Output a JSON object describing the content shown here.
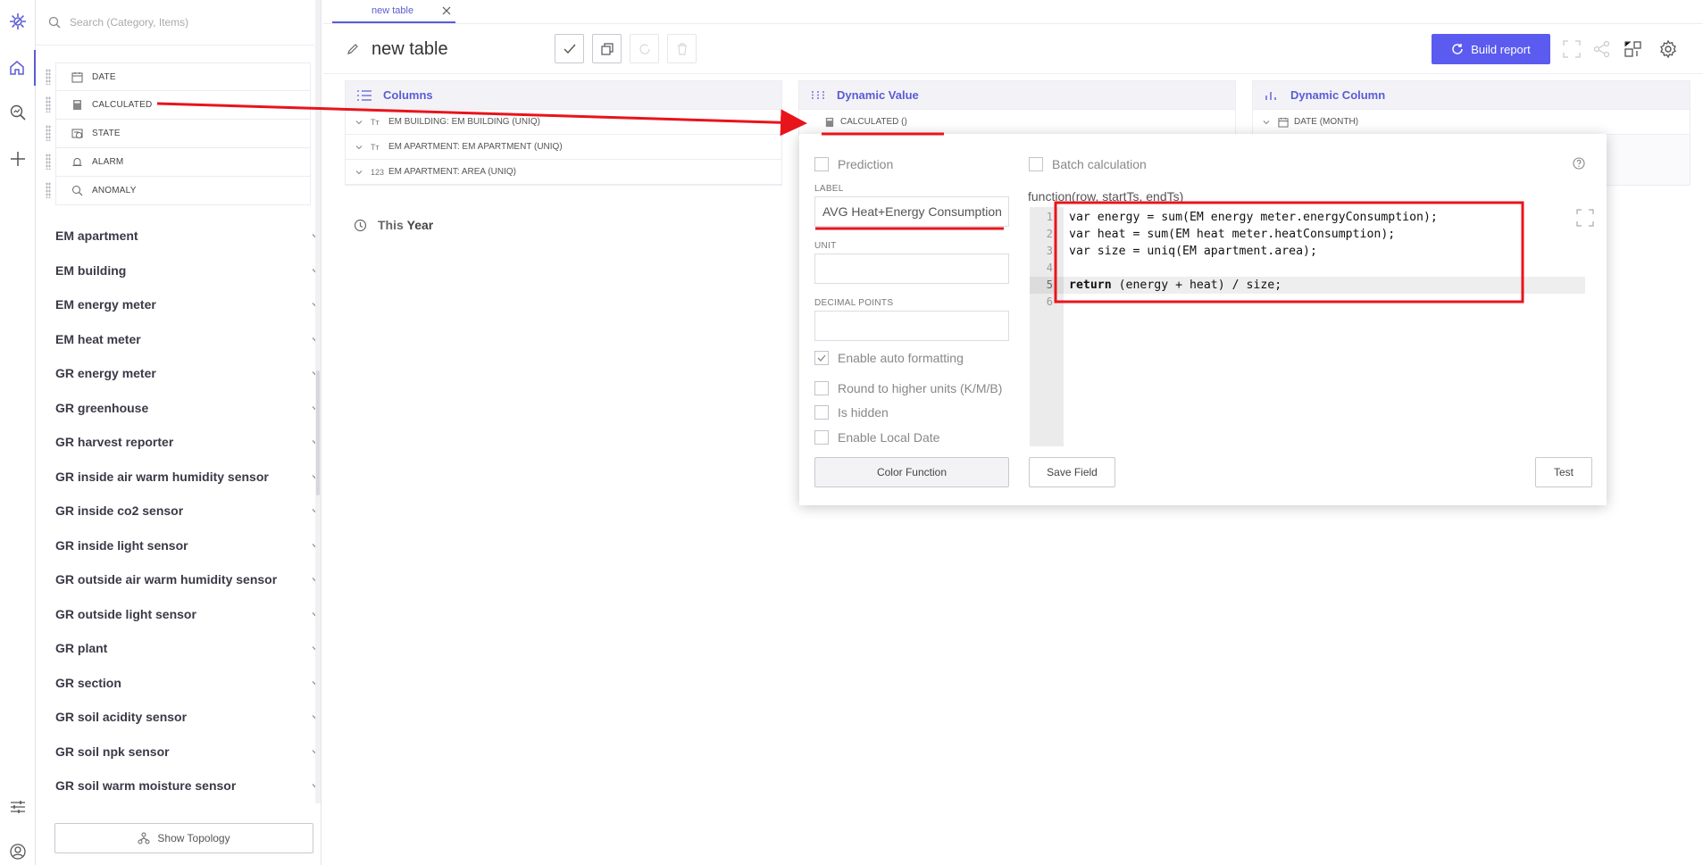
{
  "sidebar": {
    "search_placeholder": "Search (Category, Items)",
    "types": [
      "DATE",
      "CALCULATED",
      "STATE",
      "ALARM",
      "ANOMALY"
    ],
    "categories": [
      "EM apartment",
      "EM building",
      "EM energy meter",
      "EM heat meter",
      "GR energy meter",
      "GR greenhouse",
      "GR harvest reporter",
      "GR inside air warm humidity sensor",
      "GR inside co2 sensor",
      "GR inside light sensor",
      "GR outside air warm humidity sensor",
      "GR outside light sensor",
      "GR plant",
      "GR section",
      "GR soil acidity sensor",
      "GR soil npk sensor",
      "GR soil warm moisture sensor"
    ],
    "show_topology_label": "Show Topology"
  },
  "tabs": [
    {
      "label": "new table"
    }
  ],
  "header": {
    "title": "new table",
    "build_report_label": "Build report",
    "accent_color": "#5b5bf0"
  },
  "panels": {
    "columns": {
      "title": "Columns",
      "rows": [
        {
          "icon": "Tт",
          "label": "EM BUILDING: EM BUILDING (UNIQ)"
        },
        {
          "icon": "Tт",
          "label": "EM APARTMENT: EM APARTMENT (UNIQ)"
        },
        {
          "icon": "123",
          "label": "EM APARTMENT: AREA (UNIQ)"
        }
      ]
    },
    "dynamic_value": {
      "title": "Dynamic Value",
      "rows": [
        {
          "label": "CALCULATED ()"
        }
      ]
    },
    "dynamic_column": {
      "title": "Dynamic Column",
      "rows": [
        {
          "label": "DATE (MONTH)"
        }
      ]
    }
  },
  "filter": {
    "prefix": "This",
    "period": "Year"
  },
  "popup": {
    "prediction_label": "Prediction",
    "batch_label": "Batch calculation",
    "label_field_label": "LABEL",
    "label_value": "AVG Heat+Energy Consumption",
    "unit_label": "UNIT",
    "unit_value": "",
    "decimal_label": "DECIMAL POINTS",
    "decimal_value": "",
    "enable_auto_formatting": "Enable auto formatting",
    "round_units": "Round to higher units (K/M/B)",
    "is_hidden": "Is hidden",
    "enable_local_date": "Enable Local Date",
    "color_function_label": "Color Function",
    "save_field_label": "Save Field",
    "test_label": "Test",
    "function_signature": "function(row, startTs, endTs)",
    "line_numbers": [
      "1",
      "2",
      "3",
      "4",
      "5",
      "6"
    ],
    "code": {
      "line1": "var energy = sum(EM energy meter.energyConsumption);",
      "line2": "var heat = sum(EM heat meter.heatConsumption);",
      "line3": "var size = uniq(EM apartment.area);",
      "line5_kw": "return",
      "line5_rest": " (energy + heat) / size;"
    }
  },
  "annotation_color": "#e8141c"
}
